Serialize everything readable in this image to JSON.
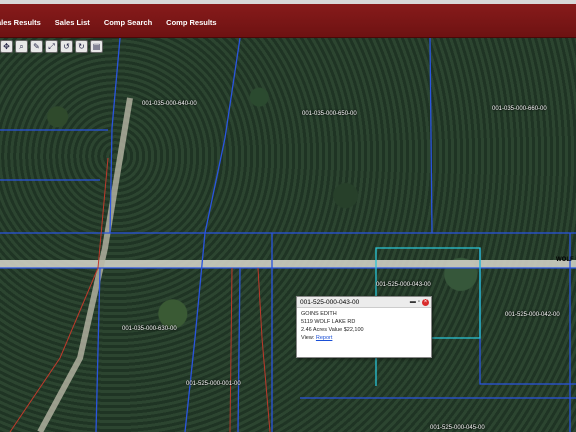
{
  "nav": {
    "items": [
      "ales Results",
      "Sales List",
      "Comp Search",
      "Comp Results"
    ]
  },
  "toolbar": {
    "icons": [
      "pan-icon",
      "zoom-icon",
      "measure-icon",
      "full-extent-icon",
      "previous-extent-icon",
      "next-extent-icon",
      "print-icon"
    ]
  },
  "map": {
    "parcels": [
      "001-035-000-640-00",
      "001-035-000-650-00",
      "001-035-000-660-00",
      "001-035-000-630-00",
      "001-525-000-043-00",
      "001-525-000-042-00",
      "001-525-000-001-00",
      "001-525-000-045-00"
    ],
    "road_label": "WOLF"
  },
  "popup": {
    "title": "001-525-000-043-00",
    "owner": "GOINS EDITH",
    "address": "5119 WOLF LAKE RD",
    "acres_value": "2.46 Acres Value $22,100",
    "view_label": "View:",
    "report_link": "Report"
  },
  "colors": {
    "header": "#7a1616",
    "parcel_line": "#2a55e0",
    "selected_line": "#29c6d6",
    "road_line": "#c0392b"
  }
}
